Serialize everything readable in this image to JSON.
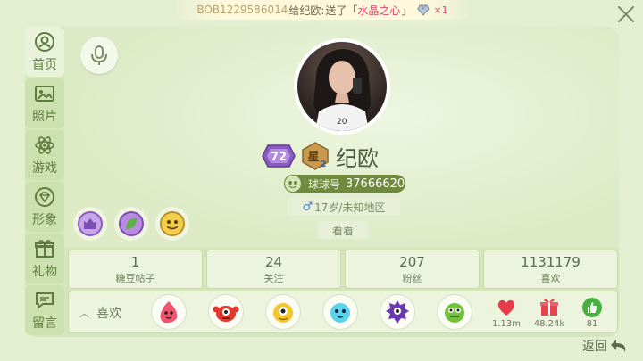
{
  "notification": {
    "user_id": "BOB1229586014",
    "verb": "给纪欧:",
    "action": " 送了「",
    "gift_name": "水晶之心",
    "action_end": "」",
    "count": "×1"
  },
  "tabs": [
    {
      "label": "首页",
      "icon": "person-icon",
      "active": true
    },
    {
      "label": "照片",
      "icon": "photo-icon",
      "active": false
    },
    {
      "label": "游戏",
      "icon": "atom-icon",
      "active": false
    },
    {
      "label": "形象",
      "icon": "gem-icon",
      "active": false
    },
    {
      "label": "礼物",
      "icon": "gift-icon",
      "active": false
    },
    {
      "label": "留言",
      "icon": "message-icon",
      "active": false
    }
  ],
  "profile": {
    "level": "72",
    "star_label": "星",
    "star_level": "2",
    "name": "纪欧",
    "id_label": "球球号",
    "id": "37666620",
    "gender": "♂",
    "location": "17岁/未知地区",
    "see_button": "看看"
  },
  "stats": [
    {
      "value": "1",
      "label": "糖豆帖子"
    },
    {
      "value": "24",
      "label": "关注"
    },
    {
      "value": "207",
      "label": "粉丝"
    },
    {
      "value": "1131179",
      "label": "喜欢"
    }
  ],
  "likes": {
    "toggle_label": "喜欢",
    "reactions": [
      {
        "icon": "heart-icon",
        "count": "1.13m",
        "color": "#e83a4a"
      },
      {
        "icon": "gift-icon",
        "count": "48.24k",
        "color": "#e8434a"
      },
      {
        "icon": "thumbs-up-icon",
        "count": "81",
        "color": "#47b040"
      }
    ]
  },
  "footer": {
    "back_label": "返回"
  },
  "colors": {
    "background": "#e4efd2",
    "panel": "#d5e6ba",
    "tab_text": "#5f7a40",
    "id_pill": "#6f8a3c"
  }
}
